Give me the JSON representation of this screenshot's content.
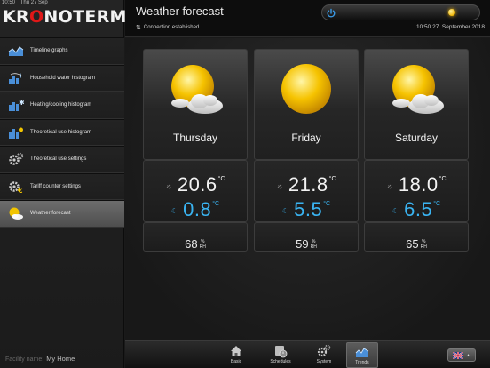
{
  "statusbar": {
    "time": "10:50",
    "date": "Thu 27 Sep"
  },
  "logo": {
    "part1": "KR",
    "part2": "O",
    "part3": "NOTERM"
  },
  "sidebar": {
    "items": [
      {
        "label": "Timeline graphs",
        "icon": "timeline-graph-icon"
      },
      {
        "label": "Household water histogram",
        "icon": "water-histogram-icon"
      },
      {
        "label": "Heating/cooling histogram",
        "icon": "heating-cooling-icon"
      },
      {
        "label": "Theoretical use histogram",
        "icon": "theoretical-histogram-icon"
      },
      {
        "label": "Theoretical use settings",
        "icon": "gears-icon"
      },
      {
        "label": "Tariff counter settings",
        "icon": "tariff-gears-icon"
      },
      {
        "label": "Weather forecast",
        "icon": "weather-icon",
        "active": true
      }
    ],
    "facility_label": "Facility name:",
    "facility_value": "My Home"
  },
  "header": {
    "title": "Weather forecast",
    "connection": "Connection established",
    "datetime": "10:50   27. September 2018"
  },
  "forecast": [
    {
      "day": "Thursday",
      "icon": "sun-cloud-icon",
      "day_temp": "20.6",
      "night_temp": "0.8",
      "humidity": "68"
    },
    {
      "day": "Friday",
      "icon": "sun-icon",
      "day_temp": "21.8",
      "night_temp": "5.5",
      "humidity": "59"
    },
    {
      "day": "Saturday",
      "icon": "sun-cloud-icon",
      "day_temp": "18.0",
      "night_temp": "6.5",
      "humidity": "65"
    }
  ],
  "units": {
    "temp": "°C",
    "hum_pct": "%",
    "hum_rh": "RH"
  },
  "nav": {
    "items": [
      {
        "label": "Basic",
        "icon": "home-icon"
      },
      {
        "label": "Schedules",
        "icon": "schedule-icon"
      },
      {
        "label": "System",
        "icon": "system-gears-icon"
      },
      {
        "label": "Trends",
        "icon": "trends-icon",
        "active": true
      }
    ],
    "language_icon": "uk-flag-icon"
  },
  "colors": {
    "accent_red": "#e01818",
    "night_blue": "#3ab4f2",
    "sun_yellow": "#f1b400"
  }
}
